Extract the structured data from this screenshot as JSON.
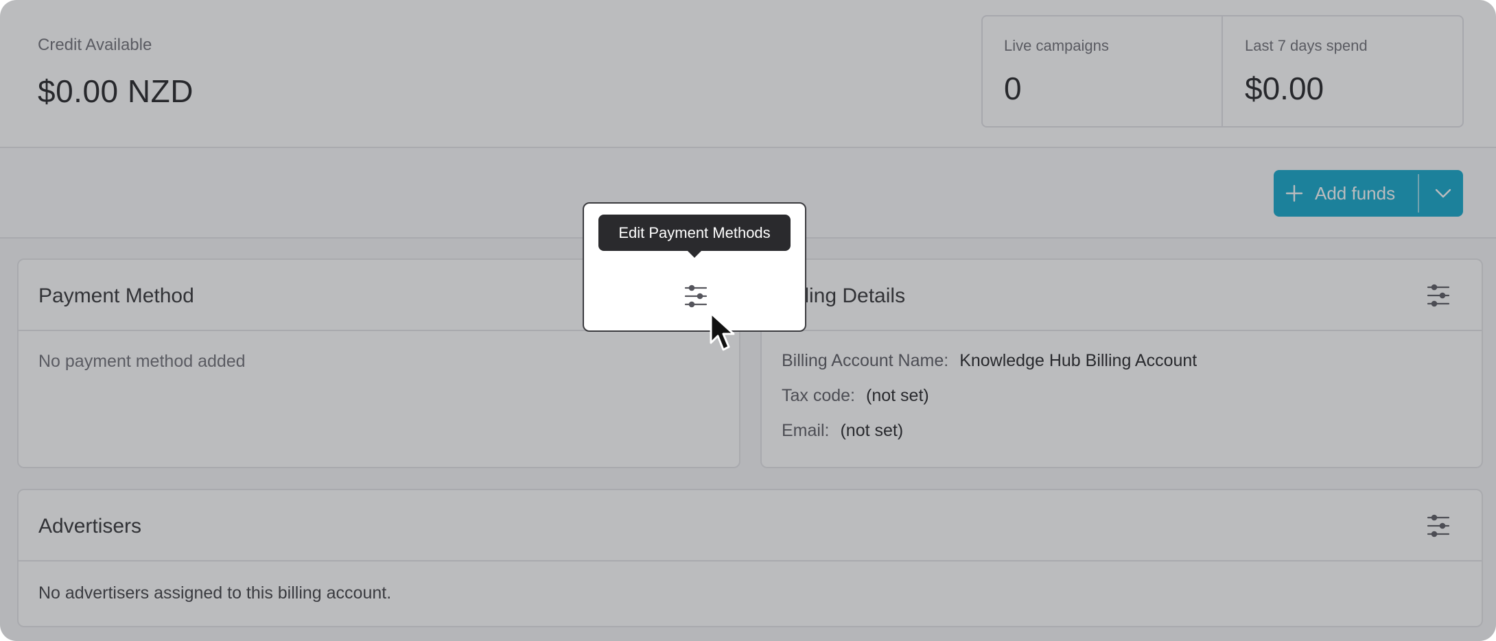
{
  "summary": {
    "credit_label": "Credit Available",
    "credit_value": "$0.00 NZD",
    "stats": [
      {
        "label": "Live campaigns",
        "value": "0"
      },
      {
        "label": "Last 7 days spend",
        "value": "$0.00"
      }
    ]
  },
  "actions": {
    "add_funds_label": "Add funds",
    "add_funds_icon": "plus-icon",
    "dropdown_icon": "chevron-down-icon",
    "accent_color": "#0ba5c9"
  },
  "payment_method": {
    "title": "Payment Method",
    "empty_text": "No payment method added",
    "edit_icon": "sliders-icon"
  },
  "billing_details": {
    "title": "Billing Details",
    "rows": [
      {
        "key": "Billing Account Name:",
        "value": "Knowledge Hub Billing Account"
      },
      {
        "key": "Tax code:",
        "value": "(not set)"
      },
      {
        "key": "Email:",
        "value": "(not set)"
      }
    ],
    "edit_icon": "sliders-icon"
  },
  "advertisers": {
    "title": "Advertisers",
    "empty_text": "No advertisers assigned to this billing account.",
    "edit_icon": "sliders-icon"
  },
  "tooltip": {
    "text": "Edit Payment Methods"
  }
}
